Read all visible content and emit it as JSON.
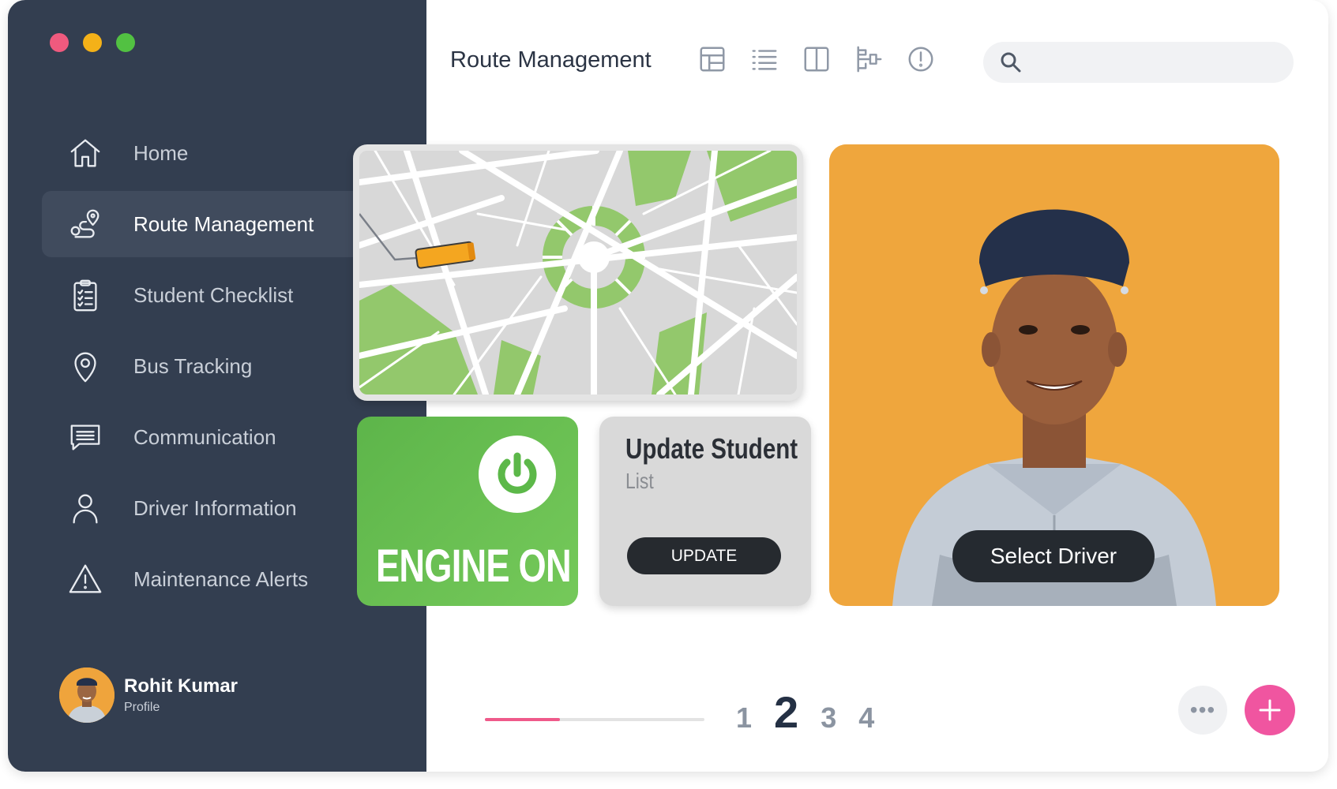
{
  "window": {
    "traffic_lights": [
      "#ef5a7e",
      "#f4b118",
      "#52c142"
    ]
  },
  "sidebar": {
    "items": [
      {
        "label": "Home",
        "icon": "home-icon"
      },
      {
        "label": "Route Management",
        "icon": "route-icon",
        "active": true
      },
      {
        "label": "Student Checklist",
        "icon": "clipboard-checklist-icon"
      },
      {
        "label": "Bus Tracking",
        "icon": "location-pin-icon"
      },
      {
        "label": "Communication",
        "icon": "chat-icon"
      },
      {
        "label": "Driver Information",
        "icon": "user-icon"
      },
      {
        "label": "Maintenance Alerts",
        "icon": "warning-icon"
      }
    ],
    "profile": {
      "name": "Rohit Kumar",
      "subtitle": "Profile"
    }
  },
  "header": {
    "title": "Route Management",
    "toolbar_icons": [
      "table-icon",
      "list-icon",
      "columns-icon",
      "hierarchy-icon",
      "info-alert-icon"
    ],
    "search": {
      "placeholder": "",
      "value": ""
    }
  },
  "cards": {
    "map": {
      "icon": "map-with-bus"
    },
    "engine": {
      "label": "ENGINE ON",
      "icon": "power-icon",
      "color": "#5db54a"
    },
    "update": {
      "title": "Update Student",
      "subtitle": "List",
      "button": "UPDATE"
    },
    "driver": {
      "button": "Select Driver",
      "color": "#efa63d"
    }
  },
  "pagination": {
    "progress": 0.34,
    "pages": [
      "1",
      "2",
      "3",
      "4"
    ],
    "current": "2"
  },
  "actions": {
    "more": "•••",
    "add_icon": "plus-icon"
  },
  "colors": {
    "sidebar_bg": "#333e50",
    "accent_pink": "#f055a0",
    "progress": "#ef5a8a"
  }
}
